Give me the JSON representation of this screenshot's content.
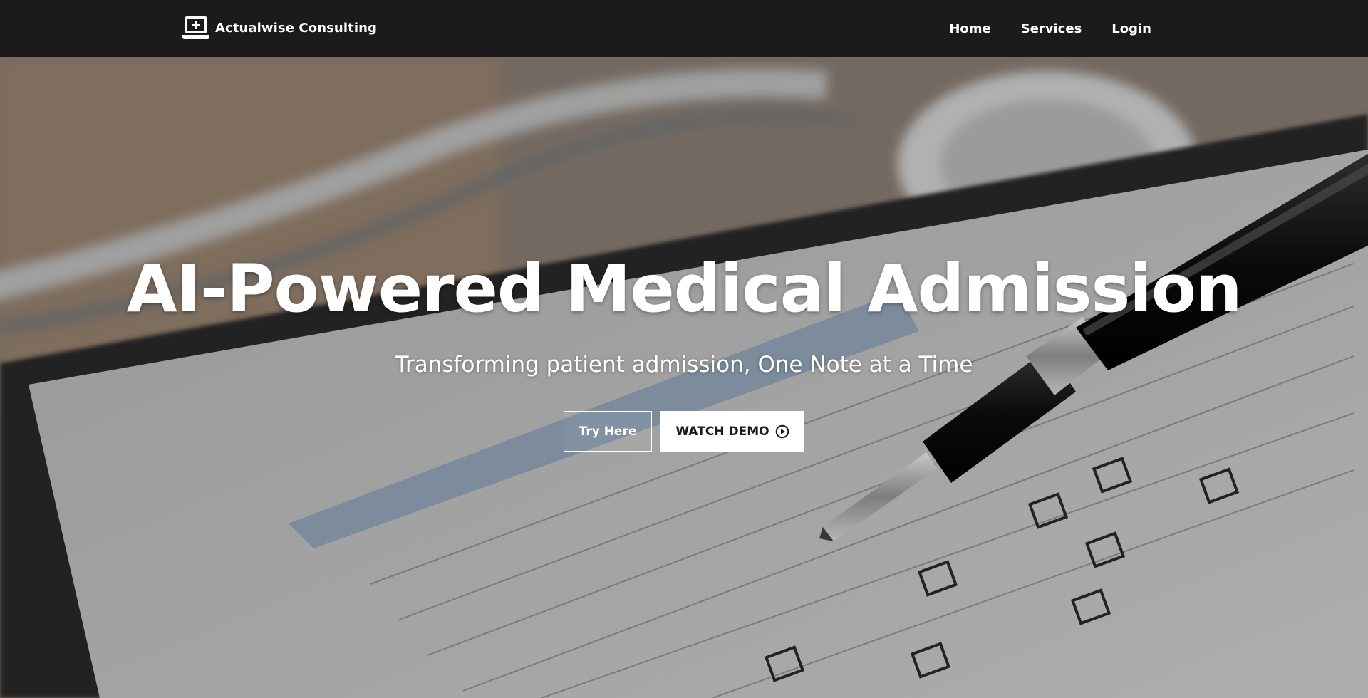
{
  "navbar": {
    "brand_name": "Actualwise Consulting",
    "brand_icon": "laptop-medical-icon",
    "links": [
      {
        "label": "Home"
      },
      {
        "label": "Services"
      },
      {
        "label": "Login"
      }
    ]
  },
  "hero": {
    "background": "medical-form-clipboard-with-pen-and-stethoscope-photo",
    "title": "AI-Powered Medical Admission",
    "subtitle": "Transforming patient admission, One Note at a Time",
    "primary_button": "Try Here",
    "secondary_button": "WATCH DEMO",
    "secondary_button_icon": "play-circle-icon"
  },
  "colors": {
    "navbar_bg": "#1c1a1b",
    "text_light": "#ffffff",
    "button_solid_bg": "#ffffff"
  }
}
